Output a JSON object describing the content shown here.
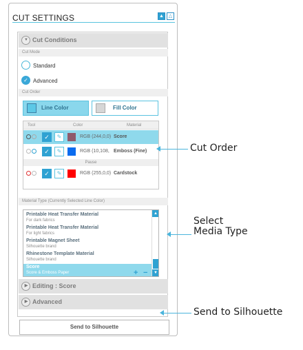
{
  "panel": {
    "title": "CUT SETTINGS",
    "up_icon": "▲",
    "down_icon": "△"
  },
  "cut_conditions": {
    "header": "Cut Conditions",
    "icon": "chevron-down-icon",
    "cut_mode_label": "Cut Mode",
    "mode_standard": "Standard",
    "mode_advanced": "Advanced",
    "selected_mode": "Advanced",
    "cut_order_label": "Cut Order",
    "line_color_button": "Line Color",
    "fill_color_button": "Fill Color",
    "table_headers": {
      "tool": "Tool",
      "color": "Color",
      "material": "Material"
    },
    "rows": [
      {
        "rgb": "RGB (244,0,0)",
        "color": "#8f5a6c",
        "material": "Score",
        "selected": true
      },
      {
        "rgb": "RGB (10,108,",
        "color": "#0a6cef",
        "material": "Emboss (Fine)",
        "selected": false
      },
      {
        "rgb": "RGB (255,0,0)",
        "color": "#ff0000",
        "material": "Cardstock",
        "selected": false
      }
    ],
    "pause_label": "Pause"
  },
  "material_type": {
    "label": "Material Type (Currently Selected Line Color)",
    "items": [
      {
        "name": "Printable Heat Transfer Material",
        "desc": "For dark fabrics"
      },
      {
        "name": "Printable Heat Transfer Material",
        "desc": "For light fabrics"
      },
      {
        "name": "Printable Magnet Sheet",
        "desc": "Silhouette brand"
      },
      {
        "name": "Rhinestone Template Material",
        "desc": "Silhouette brand"
      },
      {
        "name": "Score",
        "desc": "Score & Emboss Paper"
      }
    ],
    "selected_index": 4,
    "add_label": "+",
    "remove_label": "−"
  },
  "editing": {
    "header": "Editing : Score"
  },
  "advanced": {
    "header": "Advanced"
  },
  "send_button": "Send to Silhouette",
  "callouts": {
    "cut_order": "Cut Order",
    "select_line1": "Select",
    "select_line2": "Media Type",
    "send": "Send to Silhouette"
  },
  "colors": {
    "accent": "#2fa2d2",
    "highlight": "#8fd9ec",
    "callout_line": "#4ab4dc"
  }
}
